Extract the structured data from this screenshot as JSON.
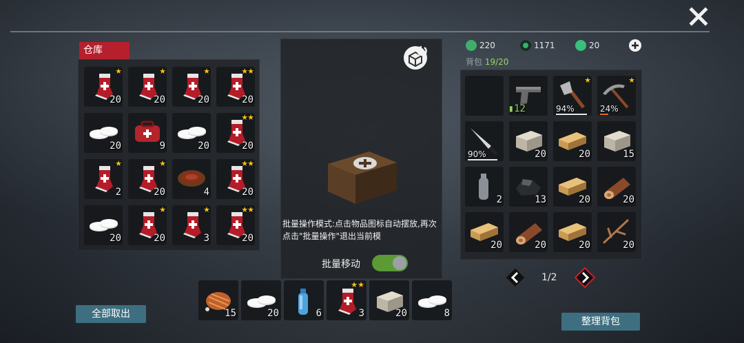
{
  "warehouse": {
    "title": "仓库",
    "items": [
      {
        "icon": "medkit-sock-icon",
        "qty": "20",
        "stars": "★"
      },
      {
        "icon": "medkit-sock-icon",
        "qty": "20",
        "stars": "★"
      },
      {
        "icon": "medkit-sock-icon",
        "qty": "20",
        "stars": "★"
      },
      {
        "icon": "medkit-sock-icon",
        "qty": "20",
        "stars": "★★"
      },
      {
        "icon": "pills-icon",
        "qty": "20",
        "stars": ""
      },
      {
        "icon": "first-aid-bag-icon",
        "qty": "9",
        "stars": ""
      },
      {
        "icon": "pills-icon",
        "qty": "20",
        "stars": ""
      },
      {
        "icon": "medkit-sock-icon",
        "qty": "20",
        "stars": "★★"
      },
      {
        "icon": "medkit-sock-icon",
        "qty": "2",
        "stars": "★"
      },
      {
        "icon": "medkit-sock-icon",
        "qty": "20",
        "stars": "★"
      },
      {
        "icon": "stew-bowl-icon",
        "qty": "4",
        "stars": ""
      },
      {
        "icon": "medkit-sock-icon",
        "qty": "20",
        "stars": "★★"
      },
      {
        "icon": "pills-icon",
        "qty": "20",
        "stars": ""
      },
      {
        "icon": "medkit-sock-icon",
        "qty": "20",
        "stars": "★"
      },
      {
        "icon": "medkit-sock-icon",
        "qty": "3",
        "stars": "★"
      },
      {
        "icon": "medkit-sock-icon",
        "qty": "20",
        "stars": "★★"
      }
    ],
    "unselect_all": "全部取出"
  },
  "center": {
    "tip": "批量操作模式:点击物品图标自动摆放,再次点击\"批量操作\"退出当前模",
    "batch_move_label": "批量移动",
    "batch_move_on": true
  },
  "resources": [
    {
      "icon": "bolt-coin-icon",
      "value": "220",
      "color": "#3fae6a"
    },
    {
      "icon": "gear-coin-icon",
      "value": "1171",
      "color": "#2eb56a"
    },
    {
      "icon": "gem-coin-icon",
      "value": "20",
      "color": "#39c07a"
    }
  ],
  "bag": {
    "label": "背包",
    "count": "19/20",
    "items": [
      {
        "icon": "empty",
        "qty": "",
        "stars": ""
      },
      {
        "icon": "pistol-icon",
        "qty": "12",
        "stars": "",
        "ammo": true
      },
      {
        "icon": "axe-icon",
        "qty": "",
        "stars": "★",
        "dura": "94%",
        "dura_frac": 0.94
      },
      {
        "icon": "pickaxe-icon",
        "qty": "",
        "stars": "★",
        "dura": "24%",
        "dura_frac": 0.24
      },
      {
        "icon": "machete-icon",
        "qty": "",
        "stars": "",
        "dura": "90%",
        "dura_frac": 0.9
      },
      {
        "icon": "stone-block-icon",
        "qty": "20",
        "stars": ""
      },
      {
        "icon": "wood-plank-icon",
        "qty": "20",
        "stars": ""
      },
      {
        "icon": "stone-block-icon",
        "qty": "15",
        "stars": ""
      },
      {
        "icon": "water-bottle-empty-icon",
        "qty": "2",
        "stars": ""
      },
      {
        "icon": "coal-ore-icon",
        "qty": "13",
        "stars": ""
      },
      {
        "icon": "wood-plank-icon",
        "qty": "20",
        "stars": ""
      },
      {
        "icon": "wood-log-icon",
        "qty": "20",
        "stars": ""
      },
      {
        "icon": "wood-plank-icon",
        "qty": "20",
        "stars": ""
      },
      {
        "icon": "wood-log-icon",
        "qty": "20",
        "stars": ""
      },
      {
        "icon": "wood-plank-icon",
        "qty": "20",
        "stars": ""
      },
      {
        "icon": "twig-icon",
        "qty": "20",
        "stars": ""
      }
    ],
    "page": "1/2",
    "organize": "整理背包"
  },
  "quickbar": [
    {
      "icon": "roast-meat-icon",
      "qty": "15",
      "stars": ""
    },
    {
      "icon": "pills-icon",
      "qty": "20",
      "stars": ""
    },
    {
      "icon": "water-bottle-icon",
      "qty": "6",
      "stars": ""
    },
    {
      "icon": "medkit-sock-icon",
      "qty": "3",
      "stars": "★★"
    },
    {
      "icon": "stone-block-icon",
      "qty": "20",
      "stars": ""
    },
    {
      "icon": "pills-icon",
      "qty": "8",
      "stars": ""
    }
  ]
}
